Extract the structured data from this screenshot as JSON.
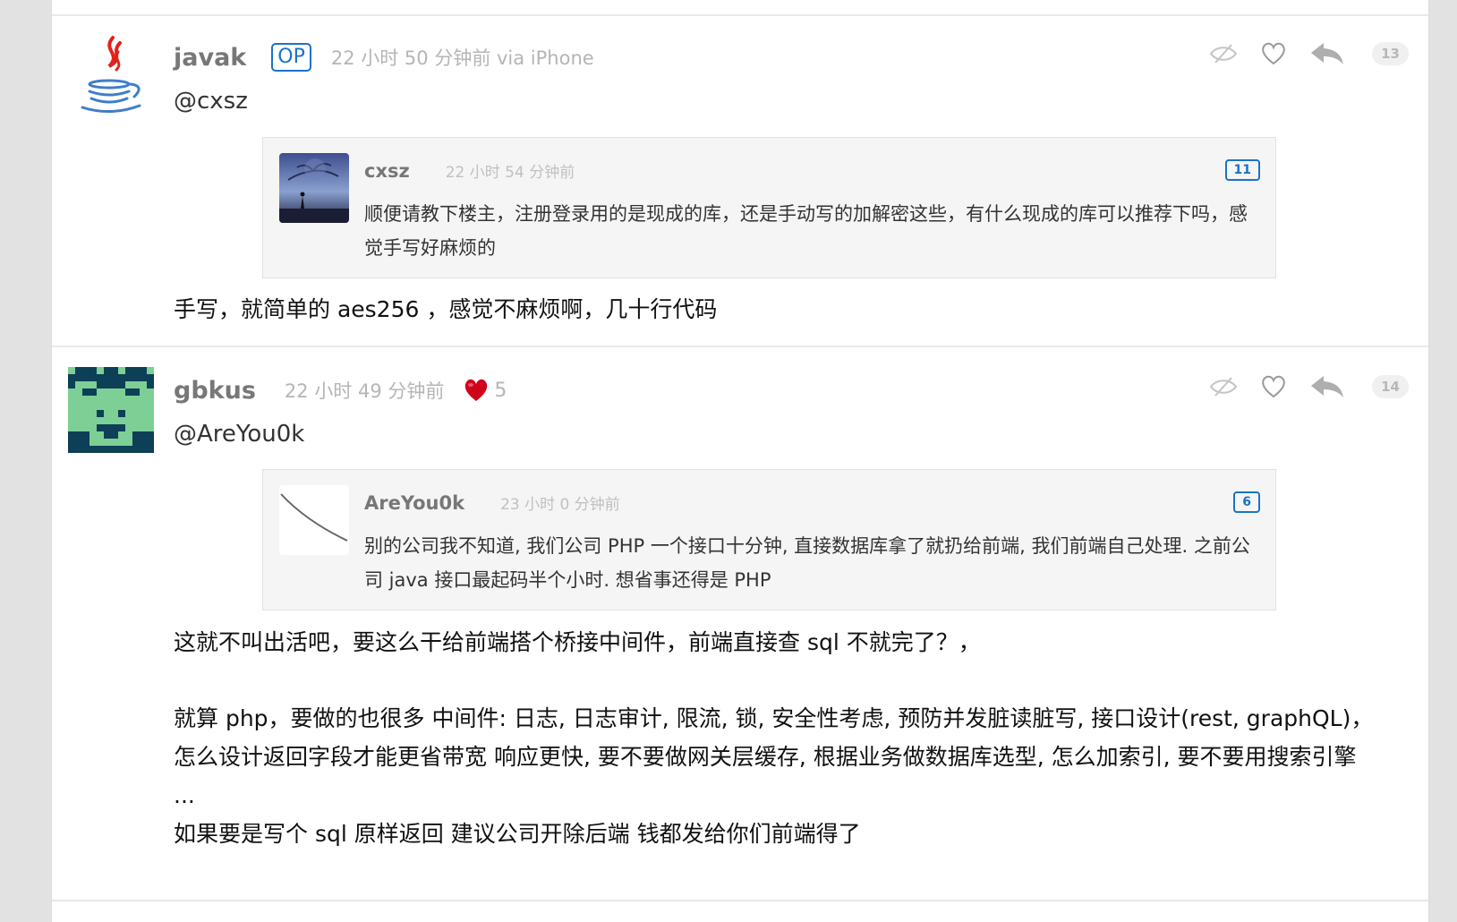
{
  "replies": [
    {
      "username": "javak",
      "op_label": "OP",
      "time": "22 小时 50 分钟前 via iPhone",
      "floor": "13",
      "mention": "@cxsz",
      "avatar_icon": "java-cup-icon",
      "quote": {
        "username": "cxsz",
        "time": "22 小时 54 分钟前",
        "floor": "11",
        "text": "顺便请教下楼主，注册登录用的是现成的库，还是手动写的加解密这些，有什么现成的库可以推荐下吗，感觉手写好麻烦的"
      },
      "body": [
        "手写，就简单的 aes256 ，感觉不麻烦啊，几十行代码"
      ]
    },
    {
      "username": "gbkus",
      "time": "22 小时 49 分钟前",
      "likes": "5",
      "floor": "14",
      "mention": "@AreYou0k",
      "avatar_icon": "pixel-face-icon",
      "quote": {
        "username": "AreYou0k",
        "time": "23 小时 0 分钟前",
        "floor": "6",
        "text": "别的公司我不知道, 我们公司 PHP 一个接口十分钟, 直接数据库拿了就扔给前端, 我们前端自己处理. 之前公司 java 接口最起码半个小时. 想省事还得是 PHP"
      },
      "body": [
        "这就不叫出活吧，要这么干给前端搭个桥接中间件，前端直接查 sql 不就完了？，",
        "就算 php，要做的也很多 中间件: 日志, 日志审计, 限流, 锁, 安全性考虑, 预防并发脏读脏写, 接口设计(rest, graphQL)，怎么设计返回字段才能更省带宽 响应更快, 要不要做网关层缓存, 根据业务做数据库选型, 怎么加索引, 要不要用搜索引擎 ...",
        "如果要是写个 sql 原样返回 建议公司开除后端 钱都发给你们前端得了"
      ]
    }
  ],
  "icons": {
    "hide": "eye-slash-icon",
    "thank": "heart-outline-icon",
    "reply": "reply-arrow-icon",
    "liked": "red-heart-icon"
  },
  "colors": {
    "op_blue": "#1a73c7",
    "heart_red": "#d0021b",
    "avatar_dark": "#0d3f57",
    "avatar_green": "#7dcf95"
  }
}
